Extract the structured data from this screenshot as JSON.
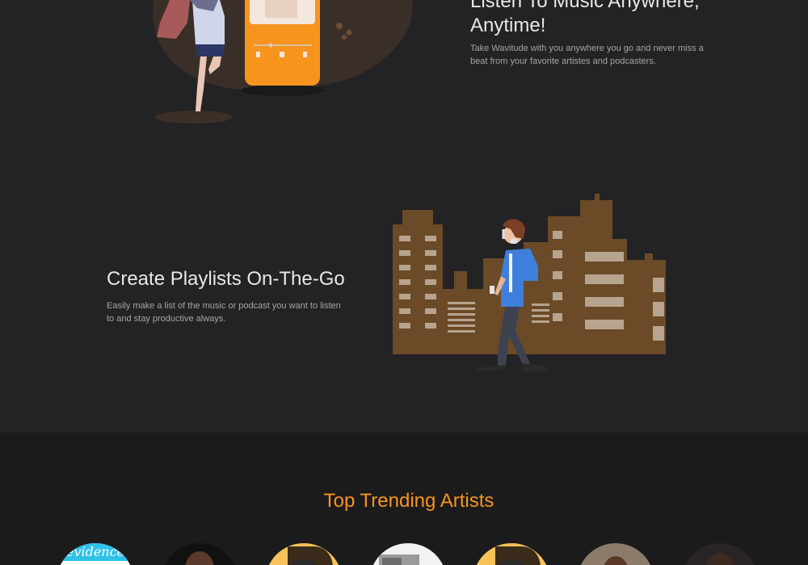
{
  "features": [
    {
      "title": "Listen To Music Anywhere, Anytime!",
      "description": "Take Wavitude with you anywhere you go and never miss a beat from your favorite artistes and podcasters.",
      "illustration": "woman-running-with-phone-illustration"
    },
    {
      "title": "Create Playlists On-The-Go",
      "description": "Easily make a list of the music or podcast you want to listen to and stay productive always.",
      "illustration": "man-walking-with-headphones-city-illustration"
    }
  ],
  "trending": {
    "title": "Top Trending Artists",
    "artists": [
      {
        "avatar": "evidence-cover-art",
        "cover_text": "evidence"
      },
      {
        "avatar": "artist-photo-2"
      },
      {
        "avatar": "placeholder-d-avatar"
      },
      {
        "avatar": "artist-photo-4"
      },
      {
        "avatar": "placeholder-d-avatar"
      },
      {
        "avatar": "artist-photo-6"
      },
      {
        "avatar": "artist-photo-7"
      }
    ]
  },
  "colors": {
    "page_background": "#232224",
    "trending_background": "#1b1b1c",
    "accent_orange": "#f7941d",
    "building_brown": "#6b4a28",
    "window_tan": "#b7a48e",
    "shirt_blue": "#3f7fdc"
  }
}
